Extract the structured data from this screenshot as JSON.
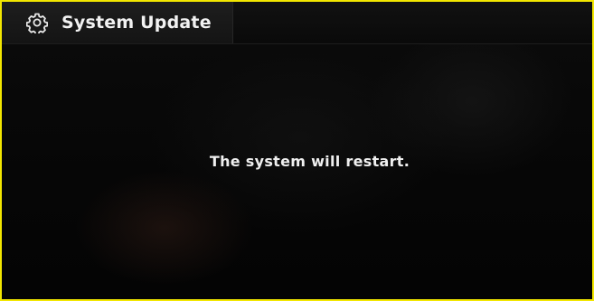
{
  "header": {
    "title": "System Update",
    "icon": "gear-icon"
  },
  "main": {
    "message": "The system will restart."
  },
  "colors": {
    "frame_border": "#f2e600",
    "background": "#050505",
    "text": "#f0f0f0"
  }
}
